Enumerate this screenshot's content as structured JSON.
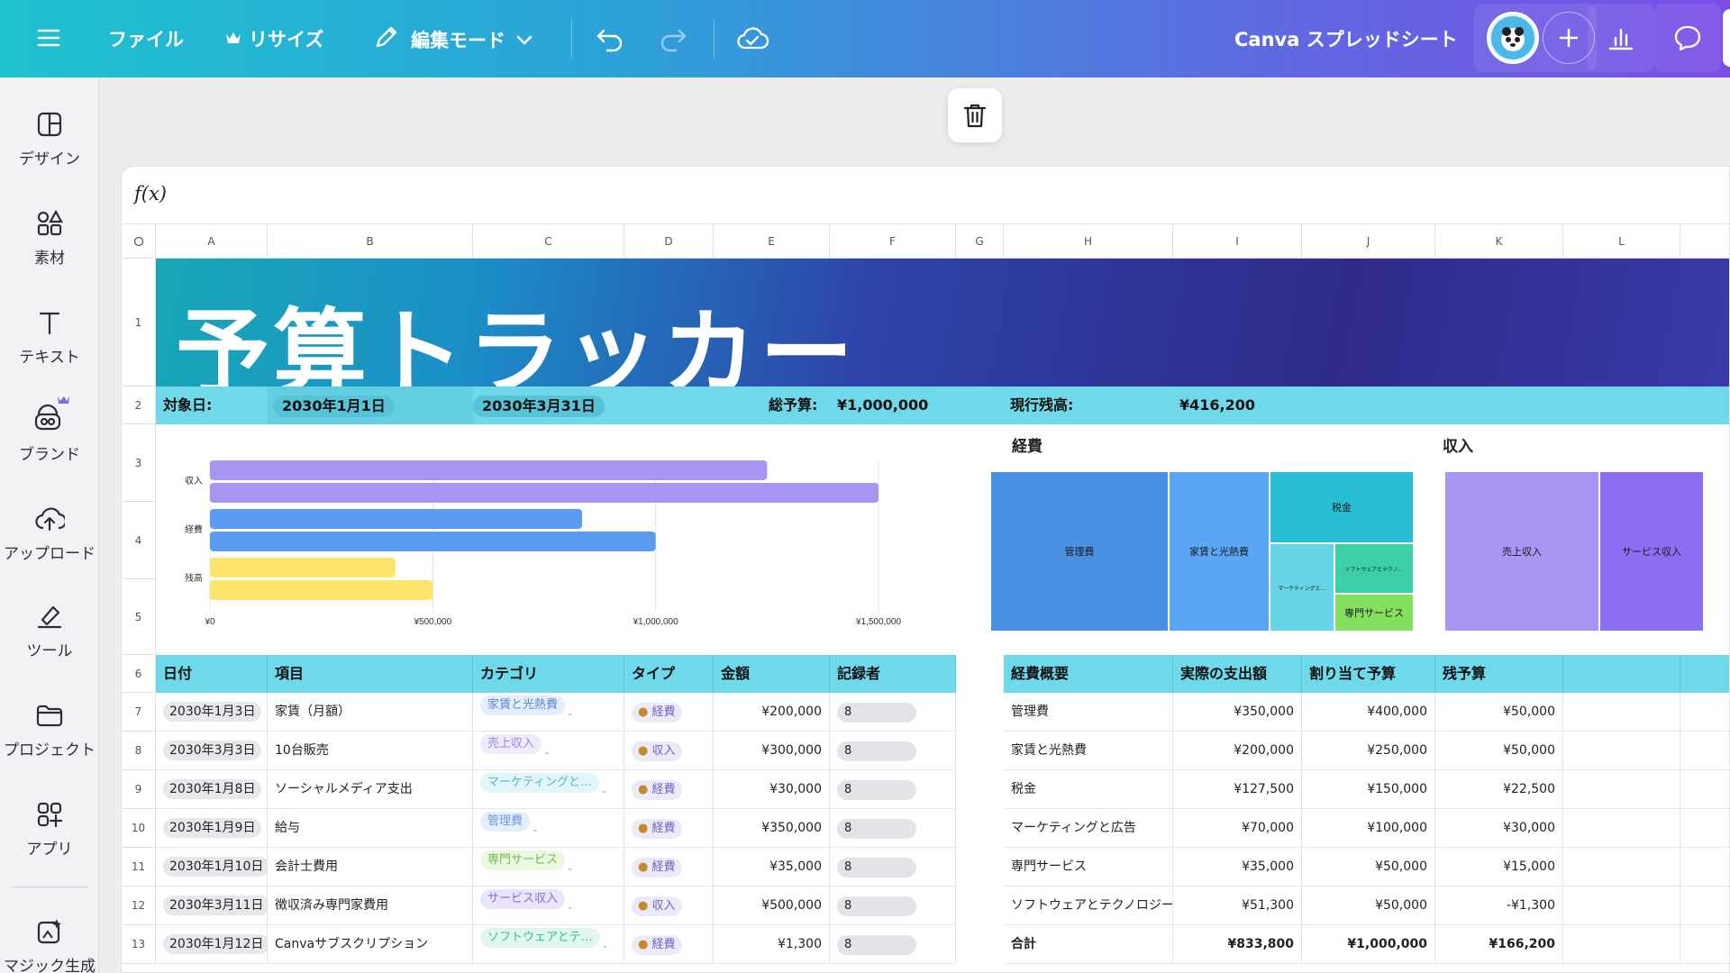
{
  "topbar": {
    "file": "ファイル",
    "resize": "リサイズ",
    "edit_mode": "編集モード",
    "doc_title": "Canva スプレッドシート"
  },
  "sidebar": {
    "items": [
      {
        "label": "デザイン",
        "icon": "design-icon"
      },
      {
        "label": "素材",
        "icon": "elements-icon"
      },
      {
        "label": "テキスト",
        "icon": "text-icon"
      },
      {
        "label": "ブランド",
        "icon": "brand-icon"
      },
      {
        "label": "アップロード",
        "icon": "upload-icon"
      },
      {
        "label": "ツール",
        "icon": "tools-icon"
      },
      {
        "label": "プロジェクト",
        "icon": "projects-icon"
      },
      {
        "label": "アプリ",
        "icon": "apps-icon"
      },
      {
        "label": "マジック生成",
        "icon": "magic-icon"
      }
    ]
  },
  "formula_bar": {
    "label": "f(x)"
  },
  "columns": [
    "A",
    "B",
    "C",
    "D",
    "E",
    "F",
    "G",
    "H",
    "I",
    "J",
    "K",
    "L"
  ],
  "rows": [
    "1",
    "2",
    "3",
    "4",
    "5",
    "6",
    "7",
    "8",
    "9",
    "10",
    "11",
    "12",
    "13"
  ],
  "banner": {
    "title": "予算トラッカー"
  },
  "summary": {
    "period_label": "対象日:",
    "start_date": "2030年1月1日",
    "end_date": "2030年3月31日",
    "total_budget_label": "総予算:",
    "total_budget": "¥1,000,000",
    "balance_label": "現行残高:",
    "balance": "¥416,200"
  },
  "chart_data": {
    "type": "bar",
    "orientation": "horizontal",
    "categories": [
      "収入",
      "経費",
      "残高"
    ],
    "series": [
      {
        "values": [
          1250000,
          835000,
          416200
        ],
        "color": "#a996f2"
      },
      {
        "values": [
          1500000,
          1000000,
          500000
        ],
        "color": "#a996f2"
      }
    ],
    "category_colors": [
      "#a996f2",
      "#5a9cf2",
      "#fce56a"
    ],
    "xlim": [
      0,
      1500000
    ],
    "xticks": [
      "¥0",
      "¥500,000",
      "¥1,000,000",
      "¥1,500,000"
    ],
    "grid": true
  },
  "expense_treemap": {
    "title": "経費",
    "cells": [
      {
        "label": "管理費",
        "color": "#4a90e2"
      },
      {
        "label": "家賃と光熱費",
        "color": "#5aa6f5"
      },
      {
        "label": "税金",
        "color": "#28bfd6"
      },
      {
        "label": "マーケティングと…",
        "color": "#68d4e8"
      },
      {
        "label": "ソフトウェアとテクノ…",
        "color": "#3ccfa8"
      },
      {
        "label": "専門サービス",
        "color": "#86e060"
      }
    ]
  },
  "income_treemap": {
    "title": "収入",
    "cells": [
      {
        "label": "売上収入",
        "color": "#a996f2"
      },
      {
        "label": "サービス収入",
        "color": "#8c6ef2"
      }
    ]
  },
  "transactions": {
    "headers": [
      "日付",
      "項目",
      "カテゴリ",
      "タイプ",
      "金額",
      "記録者"
    ],
    "rows": [
      {
        "date": "2030年1月3日",
        "item": "家賃（月額）",
        "category": "家賃と光熱費",
        "type": "経費",
        "amount": "¥200,000",
        "recorder": "8"
      },
      {
        "date": "2030年3月3日",
        "item": "10台販売",
        "category": "売上収入",
        "type": "収入",
        "amount": "¥300,000",
        "recorder": "8"
      },
      {
        "date": "2030年1月8日",
        "item": "ソーシャルメディア支出",
        "category": "マーケティングと…",
        "type": "経費",
        "amount": "¥30,000",
        "recorder": "8"
      },
      {
        "date": "2030年1月9日",
        "item": "給与",
        "category": "管理費",
        "type": "経費",
        "amount": "¥350,000",
        "recorder": "8"
      },
      {
        "date": "2030年1月10日",
        "item": "会計士費用",
        "category": "専門サービス",
        "type": "経費",
        "amount": "¥35,000",
        "recorder": "8"
      },
      {
        "date": "2030年3月11日",
        "item": "徴収済み専門家費用",
        "category": "サービス収入",
        "type": "収入",
        "amount": "¥500,000",
        "recorder": "8"
      },
      {
        "date": "2030年1月12日",
        "item": "Canvaサブスクリプション",
        "category": "ソフトウェアとテ…",
        "type": "経費",
        "amount": "¥1,300",
        "recorder": "8"
      }
    ]
  },
  "expense_summary": {
    "headers": [
      "経費概要",
      "実際の支出額",
      "割り当て予算",
      "残予算"
    ],
    "rows": [
      {
        "name": "管理費",
        "actual": "¥350,000",
        "budget": "¥400,000",
        "remaining": "¥50,000"
      },
      {
        "name": "家賃と光熱費",
        "actual": "¥200,000",
        "budget": "¥250,000",
        "remaining": "¥50,000"
      },
      {
        "name": "税金",
        "actual": "¥127,500",
        "budget": "¥150,000",
        "remaining": "¥22,500"
      },
      {
        "name": "マーケティングと広告",
        "actual": "¥70,000",
        "budget": "¥100,000",
        "remaining": "¥30,000"
      },
      {
        "name": "専門サービス",
        "actual": "¥35,000",
        "budget": "¥50,000",
        "remaining": "¥15,000"
      },
      {
        "name": "ソフトウェアとテクノロジー",
        "actual": "¥51,300",
        "budget": "¥50,000",
        "remaining": "-¥1,300"
      },
      {
        "name": "合計",
        "actual": "¥833,800",
        "budget": "¥1,000,000",
        "remaining": "¥166,200"
      }
    ]
  }
}
